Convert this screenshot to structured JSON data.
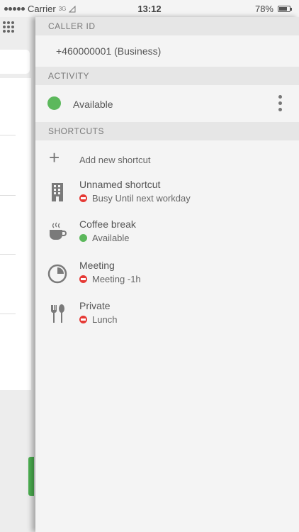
{
  "status_bar": {
    "carrier": "Carrier",
    "network": "3G",
    "time": "13:12",
    "battery": "78%",
    "battery_level": 0.78
  },
  "sections": {
    "caller_id": "CALLER ID",
    "activity": "ACTIVITY",
    "shortcuts": "SHORTCUTS"
  },
  "caller_id_value": "+460000001 (Business)",
  "activity": {
    "label": "Available",
    "status_color": "#5cb85c"
  },
  "add_shortcut_label": "Add new shortcut",
  "shortcuts": [
    {
      "title": "Unnamed shortcut",
      "status": "Busy Until next workday",
      "status_type": "busy",
      "icon": "building-icon"
    },
    {
      "title": "Coffee break",
      "status": "Available",
      "status_type": "available",
      "icon": "coffee-cup-icon"
    },
    {
      "title": "Meeting",
      "status": "Meeting -1h",
      "status_type": "busy",
      "icon": "clock-icon"
    },
    {
      "title": "Private",
      "status": "Lunch",
      "status_type": "busy",
      "icon": "fork-spoon-icon"
    }
  ],
  "colors": {
    "available": "#5cb85c",
    "busy": "#e53935",
    "section_header_bg": "#e6e6e6"
  }
}
